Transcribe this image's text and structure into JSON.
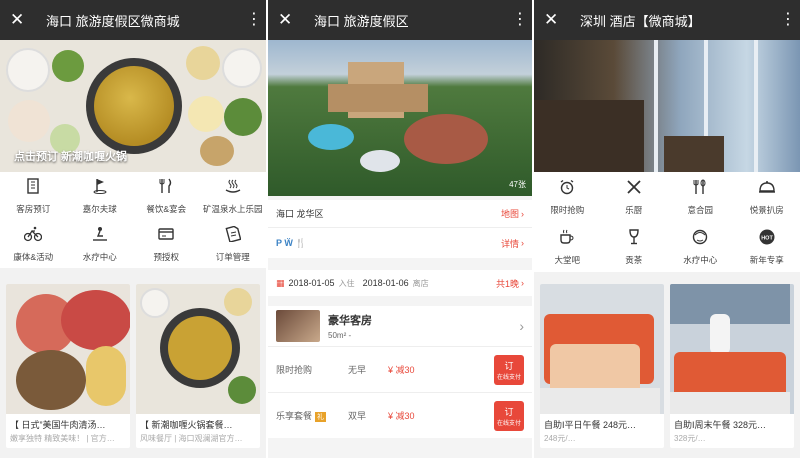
{
  "phone1": {
    "title": "海口        旅游度假区微商城",
    "banner_caption": "点击预订 新潮咖喱火锅",
    "menu": [
      {
        "label": "客房预订",
        "icon": "building-icon"
      },
      {
        "label": "嘉尔夫球",
        "icon": "golf-icon"
      },
      {
        "label": "餐饮&宴会",
        "icon": "dining-icon"
      },
      {
        "label": "矿温泉水上乐园",
        "icon": "hot-spring-icon"
      },
      {
        "label": "康体&活动",
        "icon": "bicycle-icon"
      },
      {
        "label": "水疗中心",
        "icon": "spa-icon"
      },
      {
        "label": "预授权",
        "icon": "card-icon"
      },
      {
        "label": "订单管理",
        "icon": "ticket-icon"
      }
    ],
    "cards": [
      {
        "title": "【 日式”美国牛肉清汤…",
        "sub": "嫩享独特 精致美味！ | 官方…"
      },
      {
        "title": "【 新潮咖喱火锅套餐…",
        "sub": "风味餐厅 | 海口观澜湖官方…"
      }
    ]
  },
  "phone2": {
    "title": "海口        旅游度假区",
    "photo_count": "47张",
    "address": "海口 龙华区",
    "map_link": "地图",
    "facilities": "P  Ẅ  🍴",
    "detail_link": "详情",
    "checkin_date": "2018-01-05",
    "checkin_label": "入住",
    "checkout_date": "2018-01-06",
    "checkout_label": "离店",
    "nights": "共1晚",
    "room_name": "豪华客房",
    "room_size": "50m² -",
    "plans": [
      {
        "name": "限时抢购",
        "tag": "",
        "breakfast": "无早",
        "price": "¥           减30",
        "book": "订",
        "book_sub": "在线支付"
      },
      {
        "name": "乐享套餐",
        "tag": "礼",
        "breakfast": "双早",
        "price": "¥           减30",
        "book": "订",
        "book_sub": "在线支付"
      }
    ]
  },
  "phone3": {
    "title": "深圳        酒店【微商城】",
    "menu": [
      {
        "label": "限时抢购",
        "icon": "alarm-clock-icon"
      },
      {
        "label": "乐厨",
        "icon": "utensils-icon"
      },
      {
        "label": "意合园",
        "icon": "cutlery-icon"
      },
      {
        "label": "悦景扒房",
        "icon": "cloche-icon"
      },
      {
        "label": "大堂吧",
        "icon": "coffee-cup-icon"
      },
      {
        "label": "贡茶",
        "icon": "wine-glass-icon"
      },
      {
        "label": "水疗中心",
        "icon": "spa-face-icon"
      },
      {
        "label": "新年专享",
        "icon": "hot-badge-icon"
      }
    ],
    "cards": [
      {
        "title": "自助I平日午餐 248元…",
        "sub": "248元/…"
      },
      {
        "title": "自助I周末午餐 328元…",
        "sub": "328元/…"
      }
    ]
  },
  "icons": {
    "close": "✕",
    "more": "⋮"
  },
  "colors": {
    "accent": "#e8483a",
    "titlebar": "#2e2e2e"
  }
}
